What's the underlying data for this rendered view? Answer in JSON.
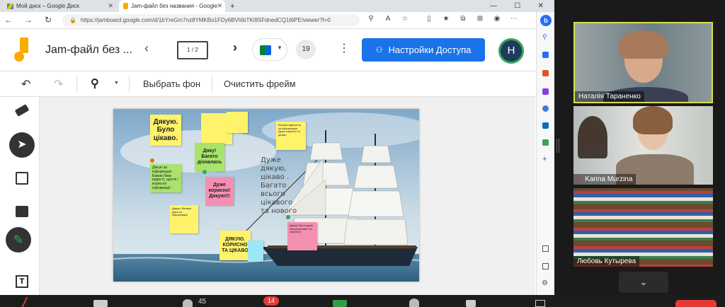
{
  "tabs": [
    {
      "label": "Мой диск – Google Диск",
      "active": false
    },
    {
      "label": "Jam-файл без названия - Google",
      "active": true
    }
  ],
  "url": "https://jamboard.google.com/d/1bYreGm7nz8YMKBo1FDy6BVIiIbTKi9SFdnedCQ1t6PE/viewer?f=0",
  "app": {
    "title": "Jam-файл без ...",
    "frame_counter": "1 / 2",
    "participants_count": "19",
    "share_button": "Настройки Доступа",
    "avatar_letter": "H"
  },
  "toolbar": {
    "set_background": "Выбрать фон",
    "clear_frame": "Очистить фрейм"
  },
  "notes": {
    "n1": "Дякую. Було цікаво.",
    "n2": "",
    "n3": "",
    "n4": "Дяку! Багато дізналась",
    "n5": "Дякую за інформацію. Бажаю Вам радості, щастя і корисної інформації.",
    "n6": "Дуже корисно! Дякую!!!",
    "n7": "Велика вдячність за інформацію. Дуже корисно та цікаво",
    "n8": "Дякую. Велика дяка за інформацію",
    "n9": "ДЯКУЮ. КОРИСНО ТА ЦІКАВО",
    "n10": "Дякую! Було дуже інформативно та корисно!",
    "n11": "",
    "handwriting": "Дуже дякую, цікаво . Багато всього цікавого та нового"
  },
  "participants": [
    {
      "name": "Наталія Тараненко"
    },
    {
      "name": "Karina Murzina"
    },
    {
      "name": "Любовь Кутырева"
    }
  ],
  "bottom": {
    "participants_count": "45",
    "chat_badge": "14"
  },
  "colors": {
    "accent": "#1a73e8",
    "sticky_yellow": "#fff36b",
    "sticky_green": "#a8e46b",
    "sticky_pink": "#f48fb1",
    "sticky_blue": "#9be7f5"
  }
}
